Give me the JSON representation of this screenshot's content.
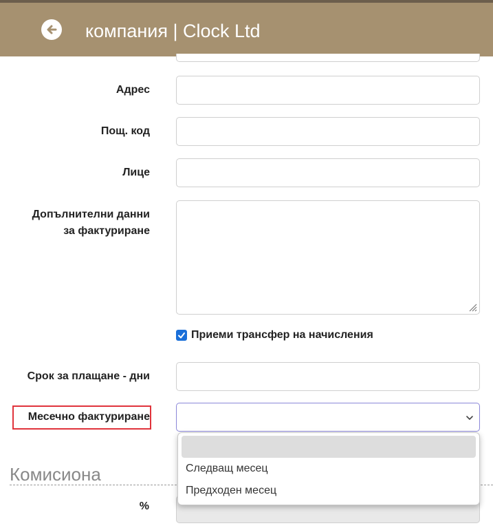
{
  "header": {
    "title": "компания | Clock Ltd"
  },
  "form": {
    "address_label": "Адрес",
    "address_value": "",
    "postcode_label": "Пощ. код",
    "postcode_value": "",
    "person_label": "Лице",
    "person_value": "",
    "additional_billing_label_line1": "Допълнителни данни",
    "additional_billing_label_line2": "за фактуриране",
    "additional_billing_value": "",
    "accept_transfer_label": "Приеми трансфер на начисления",
    "accept_transfer_checked": true,
    "payment_term_label": "Срок за плащане - дни",
    "payment_term_value": "",
    "monthly_billing_label": "Месечно фактуриране",
    "monthly_billing_value": ""
  },
  "dropdown": {
    "options": [
      "",
      "Следващ месец",
      "Предходен месец"
    ]
  },
  "commissions": {
    "title": "Комисиона",
    "percent_label": "%"
  },
  "colors": {
    "header_bg": "#a69170",
    "checkbox_accent": "#1a6fd9",
    "highlight_border": "#e0333b"
  }
}
